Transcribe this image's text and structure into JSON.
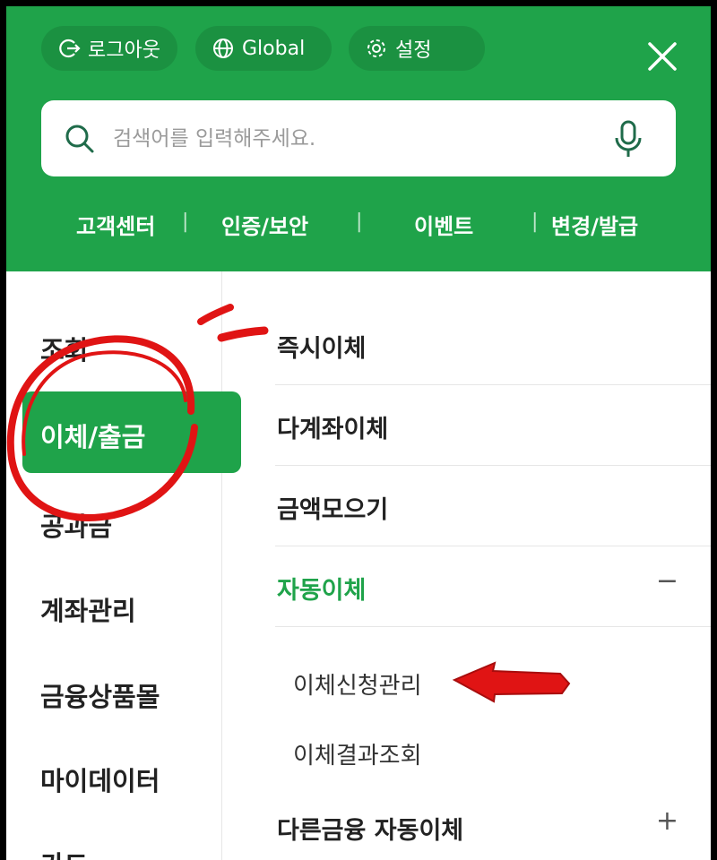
{
  "header": {
    "logout_label": "로그아웃",
    "global_label": "Global",
    "settings_label": "설정",
    "search_placeholder": "검색어를 입력해주세요.",
    "quick_links": [
      "고객센터",
      "인증/보안",
      "이벤트",
      "변경/발급"
    ],
    "quick_separator": "|"
  },
  "left_nav": {
    "items": [
      "조회",
      "이체/출금",
      "공과금",
      "계좌관리",
      "금융상품몰",
      "마이데이터",
      "카드"
    ],
    "active_index": 1
  },
  "submenu": {
    "items": [
      "즉시이체",
      "다계좌이체",
      "금액모으기",
      "자동이체"
    ],
    "expanded_index": 3,
    "expanded_toggle": "−",
    "children": [
      "이체신청관리",
      "이체결과조회"
    ],
    "other": "다른금융 자동이체",
    "other_toggle": "+"
  },
  "colors": {
    "brand_green": "#1fa34a",
    "pill_green": "#1b9141",
    "annotation_red": "#e01414"
  },
  "icons": {
    "logout": "logout-icon",
    "global": "globe-icon",
    "settings": "gear-icon",
    "close": "close-icon",
    "search": "search-icon",
    "mic": "microphone-icon"
  }
}
